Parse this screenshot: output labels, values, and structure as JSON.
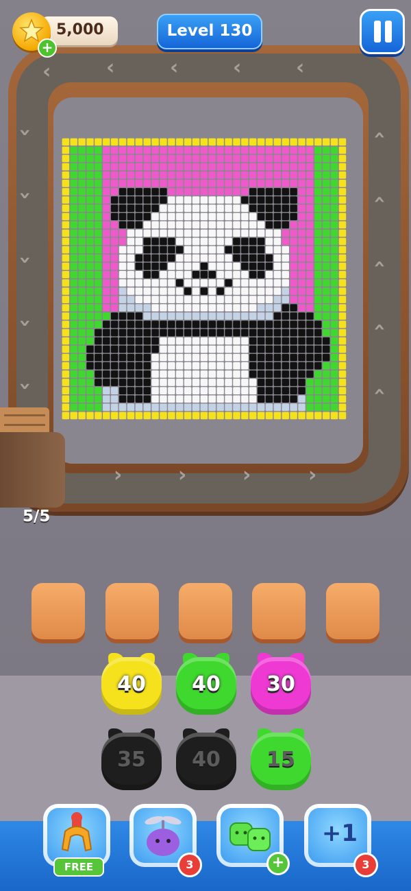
{
  "header": {
    "coins": "5,000",
    "level": "Level 130",
    "coin_icon": "star-coin-icon",
    "add_coins_icon": "plus-icon",
    "pause_icon": "pause-icon"
  },
  "conveyor": {
    "counter": "5/5"
  },
  "picture": {
    "rows": [
      "YYYYYYYYYYYYYYYYYYYYYYYYYYYYYYYYYYY",
      "YGGGGPPPPPPPPPPPPPPPPPPPPPPPPPPGGGY",
      "YGGGGPPPPPPPPPPPPPPPPPPPPPPPPPPGGGY",
      "YGGGGPPPPPPPPPPPPPPPPPPPPPPPPPPGGGY",
      "YGGGGPPPPPPPPPPPPPPPPPPPPPPPPPPGGGY",
      "YGGGGPPPPPPPPPPPPPPPPPPPPPPPPPPGGGY",
      "YGGGGPPBBBBBBPPPPPPPPPPBBBBBBPPGGGY",
      "YGGGGPBBBBBBBWWWWWWWWWBBBBBBBPPGGGY",
      "YGGGGPBBBBBBWWWWWWWWWWWBBBBBBPPGGGY",
      "YGGGGPBBBBBWWWWWWWWWWWWWBBBBBPPGGGY",
      "YGGGGPPBBBWWWWWWWWWWWWWWWBBBPPPGGGY",
      "YGGGGPPPWWWWWWWWWWWWWWWWWWWPPPPGGGY",
      "YGGGGPPPWWBBBBWWWWWWWBBBBWWPPPPGGGY",
      "YGGGGPPWWWBBBBBWWWWWBBBBBWWWPPPGGGY",
      "YGGGGPPWWBBBBBWWWWWWWBBBBBWWPPPGGGY",
      "YGGGGPPWWBBBBWWWWBWWWWBBBBWWPPPGGGY",
      "YGGGGPPWWWBBWWWWBBBWWWWBBWWWPPPGGGY",
      "YGGGGPPWWWWWWWBWWWWWBWWWWWWWPPPGGGY",
      "YGGGGPPLWWWWWWWBWBWBWWWWWWWLPPPGGGY",
      "YGGGGPPLLWWWWWWWWWWWWWWWWWLLPPPGGGY",
      "YGGGGPPLLLLWWWWWWWWWWWWWLLLBBPPGGGY",
      "YGGGGGBBBBLLLLLLLLLLLLLLLLBBBBBGGGY",
      "YGGGGBBBBBBBBBBBBBBBBBBBBBBBBBBBGGY",
      "YGGGBBBBBBBBBBBBBBBBBBBBBBBBBBBBGGY",
      "YGGGBBBBBBBBWWWWWWWWWWWBBBBBBBBBBGY",
      "YGGBBBBBBBBBWWWWWWWWWWWBBBBBBBBBBGY",
      "YGGBBBBBBBBWWWWWWWWWWWWBBBBBBBBBBGY",
      "YGGBBBBBBBBWWWWWWWWWWWWBBBBBBBBBGGY",
      "YGGGBBBBBBBWWWWWWWWWWWWBBBBBBBBGGGY",
      "YGGGBBBBBBBWWWWWWWWWWWWWBBBBBBGGGGY",
      "YGGGGLLBBBBWWWWWWWWWWWWWBBBBBBGGGGY",
      "YGGGGLLBBBBWWWWWWWWWWWWWBBBBBLGGGGY",
      "YGGGGLLLLLLLLLLLLLLLLLLLLLLLLLGGGGY",
      "YYYYYYYYYYYYYYYYYYYYYYYYYYYYYYYYYYY"
    ],
    "palette": {
      "Y": "#f5e21c",
      "G": "#3fd82e",
      "P": "#ee5ac9",
      "B": "#121212",
      "W": "#f7f7f7",
      "L": "#c4d2e6"
    }
  },
  "slots": {
    "count": 5
  },
  "pieces": [
    {
      "value": "40",
      "color": "#f5e21c",
      "state": "active"
    },
    {
      "value": "40",
      "color": "#3fd82e",
      "state": "active"
    },
    {
      "value": "30",
      "color": "#ee3ad3",
      "state": "active"
    },
    {
      "value": "35",
      "color": "#1e1e1e",
      "state": "shadow"
    },
    {
      "value": "40",
      "color": "#1e1e1e",
      "state": "shadow"
    },
    {
      "value": "15",
      "color": "#3fd82e",
      "state": "shadow"
    }
  ],
  "boosters": [
    {
      "name": "claw-icon",
      "badge": "FREE"
    },
    {
      "name": "fan-jelly-icon",
      "badge": "3"
    },
    {
      "name": "jelly-pair-icon",
      "badge": "+"
    },
    {
      "name": "plus-one-icon",
      "label": "+1",
      "badge": "3"
    }
  ]
}
